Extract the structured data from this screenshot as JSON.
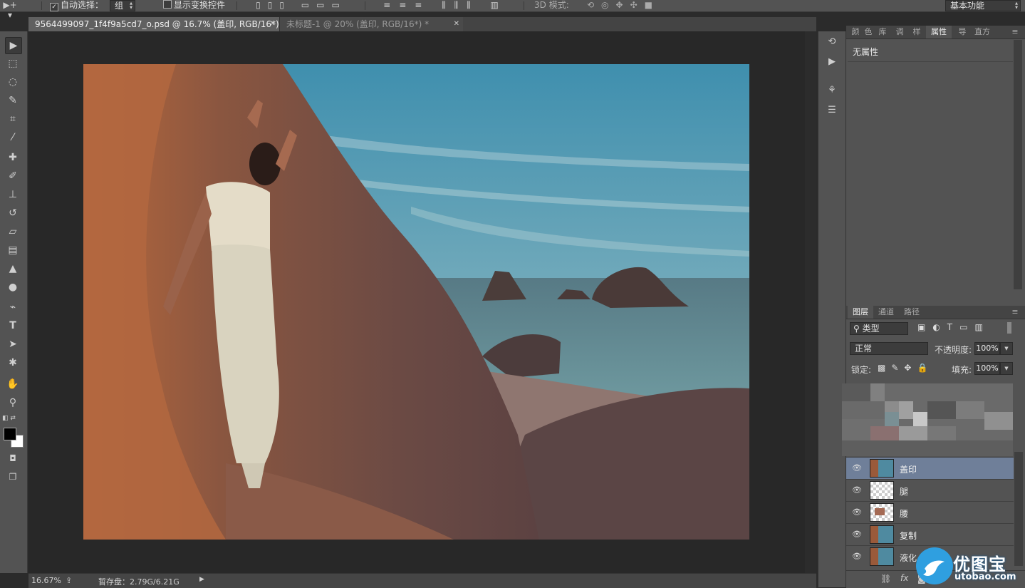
{
  "options_bar": {
    "auto_select_label": "自动选择：",
    "auto_select_value": "组",
    "show_transform_label": "显示变换控件",
    "mode_3d_label": "3D 模式:",
    "workspace_value": "基本功能"
  },
  "tabs": [
    {
      "label": "9564499097_1f4f9a5cd7_o.psd @ 16.7% (盖印, RGB/16*) *"
    },
    {
      "label": "未标题-1 @ 20% (盖印, RGB/16*) *"
    }
  ],
  "status": {
    "zoom": "16.67%",
    "scratch": "暂存盘：2.79G/6.21G"
  },
  "properties_panel": {
    "tabs": [
      "颜",
      "色",
      "库",
      "调",
      "样",
      "属性",
      "导",
      "直方"
    ],
    "active_tab": "属性",
    "content": "无属性"
  },
  "layers_panel": {
    "tabs": [
      "图层",
      "通道",
      "路径"
    ],
    "filter_kind": "类型",
    "blend_mode": "正常",
    "opacity_label": "不透明度:",
    "opacity_value": "100%",
    "lock_label": "锁定:",
    "fill_label": "填充:",
    "fill_value": "100%",
    "layers": [
      {
        "name": "盖印",
        "selected": true,
        "thumb": "photo"
      },
      {
        "name": "腿",
        "selected": false,
        "thumb": "transparent"
      },
      {
        "name": "腰",
        "selected": false,
        "thumb": "partial"
      },
      {
        "name": "复制",
        "selected": false,
        "thumb": "photo"
      },
      {
        "name": "液化",
        "selected": false,
        "thumb": "photo"
      }
    ]
  },
  "watermark": {
    "text_cn": "优图宝",
    "text_en": "utobao.com"
  },
  "colors": {
    "panel": "#535353",
    "canvas_bg": "#282828",
    "selected_layer": "#6f7f99",
    "sky": "#4f93ab",
    "rock": "#8a5a44"
  }
}
